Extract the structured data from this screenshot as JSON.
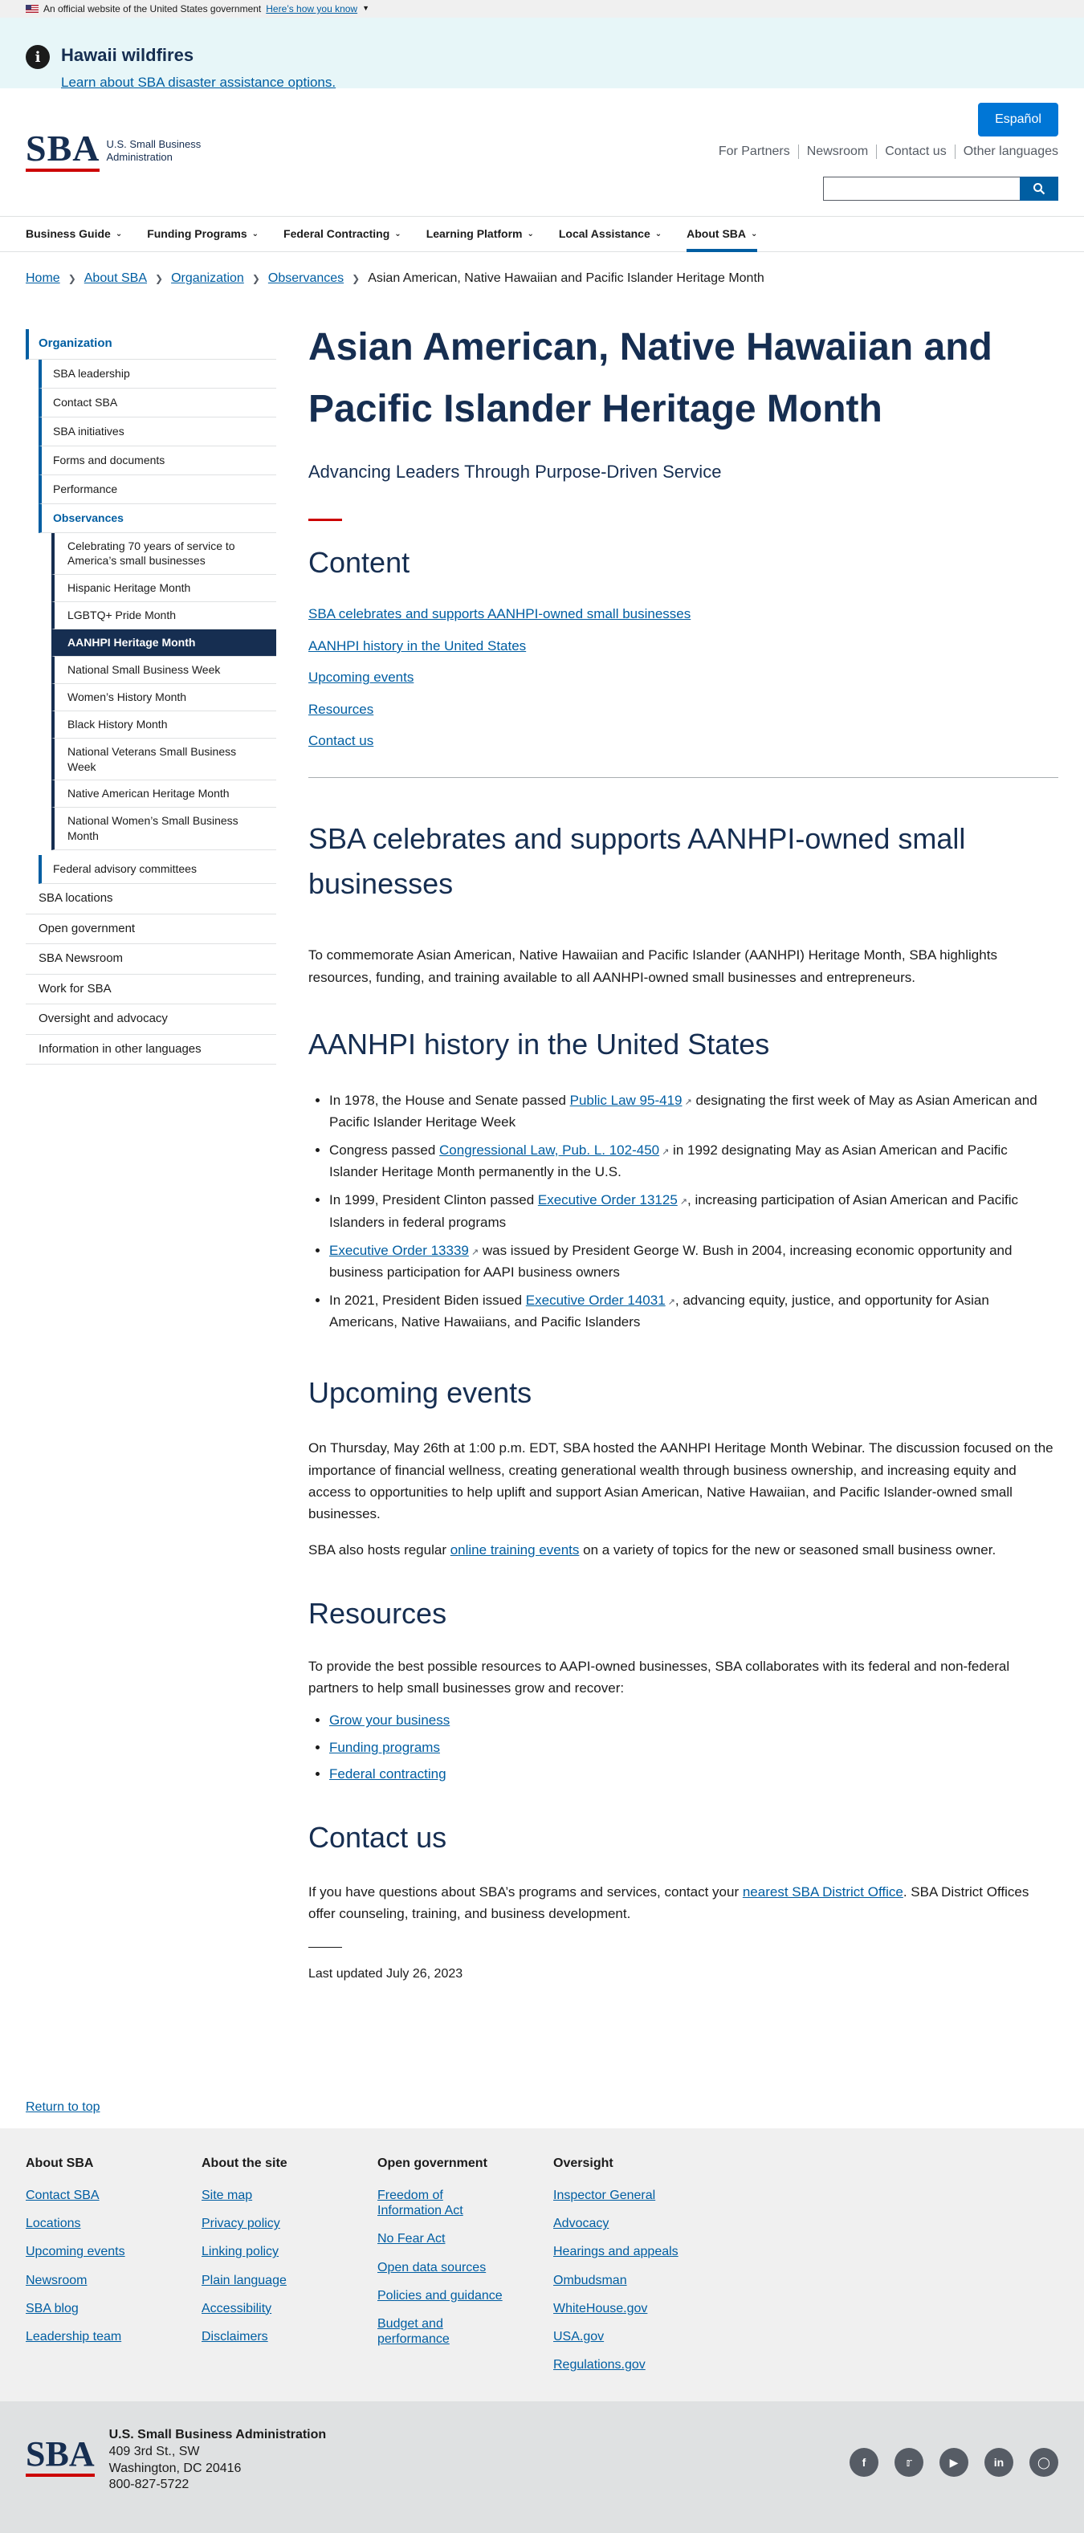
{
  "gov_banner": {
    "text": "An official website of the United States government",
    "link": "Here’s how you know"
  },
  "alert": {
    "title": "Hawaii wildfires",
    "link": "Learn about SBA disaster assistance options."
  },
  "header": {
    "logo_text": "SBA",
    "agency_line1": "U.S. Small Business",
    "agency_line2": "Administration",
    "espanol": "Español",
    "secondary_nav": [
      "For Partners",
      "Newsroom",
      "Contact us",
      "Other languages"
    ]
  },
  "main_nav": [
    "Business Guide",
    "Funding Programs",
    "Federal Contracting",
    "Learning Platform",
    "Local Assistance",
    "About SBA"
  ],
  "breadcrumb": [
    "Home",
    "About SBA",
    "Organization",
    "Observances",
    "Asian American, Native Hawaiian and Pacific Islander Heritage Month"
  ],
  "sidebar": {
    "top": "Organization",
    "level2": [
      "SBA leadership",
      "Contact SBA",
      "SBA initiatives",
      "Forms and documents",
      "Performance",
      "Observances"
    ],
    "level3": [
      "Celebrating 70 years of service to America’s small businesses",
      "Hispanic Heritage Month",
      "LGBTQ+ Pride Month",
      "AANHPI Heritage Month",
      "National Small Business Week",
      "Women’s History Month",
      "Black History Month",
      "National Veterans Small Business Week",
      "Native American Heritage Month",
      "National Women’s Small Business Month"
    ],
    "level2_after": "Federal advisory committees",
    "level1_after": [
      "SBA locations",
      "Open government",
      "SBA Newsroom",
      "Work for SBA",
      "Oversight and advocacy",
      "Information in other languages"
    ]
  },
  "page": {
    "title": "Asian American, Native Hawaiian and Pacific Islander Heritage Month",
    "subtitle": "Advancing Leaders Through Purpose-Driven Service",
    "content_heading": "Content",
    "toc": [
      "SBA celebrates and supports AANHPI-owned small businesses",
      "AANHPI history in the United States",
      "Upcoming events",
      "Resources",
      "Contact us"
    ],
    "s1_heading": "SBA celebrates and supports AANHPI-owned small businesses",
    "s1_text": "To commemorate Asian American, Native Hawaiian and Pacific Islander (AANHPI) Heritage Month, SBA highlights resources, funding, and training available to all AANHPI-owned small businesses and entrepreneurs.",
    "s2_heading": "AANHPI history in the United States",
    "history": [
      {
        "pre": "In 1978, the House and Senate passed ",
        "link": "Public Law 95-419",
        "post": " designating the first week of May as Asian American and Pacific Islander Heritage Week"
      },
      {
        "pre": "Congress passed ",
        "link": "Congressional Law, Pub. L. 102-450",
        "post": " in 1992 designating May as Asian American and Pacific Islander Heritage Month permanently in the U.S."
      },
      {
        "pre": "In 1999, President Clinton passed ",
        "link": "Executive Order 13125",
        "post": ", increasing participation of Asian American and Pacific Islanders in federal programs"
      },
      {
        "pre": "",
        "link": "Executive Order 13339",
        "post": " was issued by President George W. Bush in 2004, increasing economic opportunity and business participation for AAPI business owners"
      },
      {
        "pre": "In 2021, President Biden issued ",
        "link": "Executive Order 14031",
        "post": ", advancing equity, justice, and opportunity for Asian Americans, Native Hawaiians, and Pacific Islanders"
      }
    ],
    "s3_heading": "Upcoming events",
    "s3_text": "On Thursday, May 26th at 1:00 p.m. EDT, SBA hosted the AANHPI Heritage Month Webinar. The discussion focused on the importance of financial wellness, creating generational wealth through business ownership, and increasing equity and access to opportunities to help uplift and support Asian American, Native Hawaiian, and Pacific Islander-owned small businesses.",
    "s3_text2_pre": "SBA also hosts regular ",
    "s3_text2_link": "online training events",
    "s3_text2_post": " on a variety of topics for the new or seasoned small business owner.",
    "s4_heading": "Resources",
    "s4_text": "To provide the best possible resources to AAPI-owned businesses, SBA collaborates with its federal and non-federal partners to help small businesses grow and recover:",
    "resources": [
      "Grow your business",
      "Funding programs",
      "Federal contracting"
    ],
    "s5_heading": "Contact us",
    "s5_pre": "If you have questions about SBA’s programs and services, contact your ",
    "s5_link": "nearest SBA District Office",
    "s5_post": ". SBA District Offices offer counseling, training, and business development.",
    "updated": "Last updated July 26, 2023"
  },
  "return_top": "Return to top",
  "footer": [
    {
      "heading": "About SBA",
      "links": [
        "Contact SBA",
        "Locations",
        "Upcoming events",
        "Newsroom",
        "SBA blog",
        "Leadership team"
      ]
    },
    {
      "heading": "About the site",
      "links": [
        "Site map",
        "Privacy policy",
        "Linking policy",
        "Plain language",
        "Accessibility",
        "Disclaimers"
      ]
    },
    {
      "heading": "Open government",
      "links": [
        "Freedom of Information Act",
        "No Fear Act",
        "Open data sources",
        "Policies and guidance",
        "Budget and performance"
      ]
    },
    {
      "heading": "Oversight",
      "links": [
        "Inspector General",
        "Advocacy",
        "Hearings and appeals",
        "Ombudsman",
        "WhiteHouse.gov",
        "USA.gov",
        "Regulations.gov"
      ]
    }
  ],
  "address": {
    "name": "U.S. Small Business Administration",
    "line1": "409 3rd St., SW",
    "line2": "Washington, DC 20416",
    "phone": "800-827-5722"
  },
  "social_icons": [
    "facebook-icon",
    "twitter-icon",
    "youtube-icon",
    "linkedin-icon",
    "instagram-icon"
  ]
}
